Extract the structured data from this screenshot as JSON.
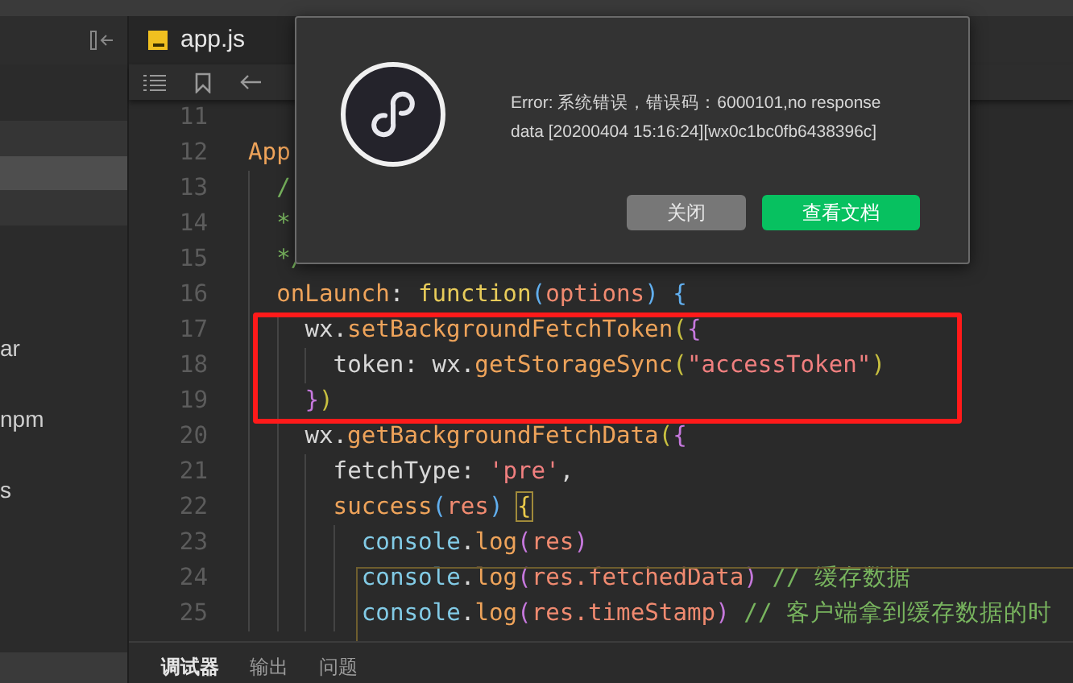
{
  "sidebar": {
    "rows": [
      {
        "selected": false
      },
      {
        "selected": true
      },
      {
        "selected": false
      }
    ],
    "items": [
      {
        "label": "ar"
      },
      {
        "label": "npm"
      },
      {
        "label": "s"
      }
    ]
  },
  "editor": {
    "tabs": [
      {
        "label": "app.js",
        "selected": true
      }
    ],
    "lines": [
      {
        "number": "11"
      },
      {
        "number": "12",
        "tokens": [
          {
            "kind": "method",
            "text": "App"
          }
        ],
        "children": [
          {
            "number": "13",
            "tokens": [
              {
                "kind": "comment",
                "text": "/"
              }
            ]
          },
          {
            "number": "14",
            "tokens": [
              {
                "kind": "comment",
                "text": "*"
              }
            ]
          },
          {
            "number": "15",
            "tokens": [
              {
                "kind": "comment",
                "text": "*/"
              }
            ]
          },
          {
            "number": "16",
            "tokens": [
              {
                "kind": "method",
                "text": "onLaunch"
              },
              {
                "kind": "text",
                "text": ": "
              },
              {
                "kind": "keyword",
                "text": "function"
              },
              {
                "kind": "brace3",
                "text": "("
              },
              {
                "kind": "param",
                "text": "options"
              },
              {
                "kind": "brace3",
                "text": ") "
              },
              {
                "kind": "brace3",
                "text": "{"
              }
            ],
            "children": [
              {
                "number": "17",
                "tokens": [
                  {
                    "kind": "text",
                    "text": "wx."
                  },
                  {
                    "kind": "method",
                    "text": "setBackgroundFetchToken"
                  },
                  {
                    "kind": "brace1",
                    "text": "("
                  },
                  {
                    "kind": "brace2",
                    "text": "{"
                  }
                ],
                "children": [
                  {
                    "number": "18",
                    "tokens": [
                      {
                        "kind": "text",
                        "text": "token: wx."
                      },
                      {
                        "kind": "method",
                        "text": "getStorageSync"
                      },
                      {
                        "kind": "brace1",
                        "text": "("
                      },
                      {
                        "kind": "string",
                        "text": "\"accessToken\""
                      },
                      {
                        "kind": "brace1",
                        "text": ")"
                      }
                    ]
                  }
                ]
              },
              {
                "number": "19",
                "tokens": [
                  {
                    "kind": "brace2",
                    "text": "}"
                  },
                  {
                    "kind": "brace1",
                    "text": ")"
                  }
                ]
              },
              {
                "number": "20",
                "tokens": [
                  {
                    "kind": "text",
                    "text": "wx."
                  },
                  {
                    "kind": "method",
                    "text": "getBackgroundFetchData"
                  },
                  {
                    "kind": "brace1",
                    "text": "("
                  },
                  {
                    "kind": "brace2",
                    "text": "{"
                  }
                ],
                "children": [
                  {
                    "number": "21",
                    "tokens": [
                      {
                        "kind": "text",
                        "text": "fetchType: "
                      },
                      {
                        "kind": "string",
                        "text": "'pre'"
                      },
                      {
                        "kind": "text",
                        "text": ","
                      }
                    ]
                  },
                  {
                    "number": "22",
                    "tokens": [
                      {
                        "kind": "method",
                        "text": "success"
                      },
                      {
                        "kind": "brace3",
                        "text": "("
                      },
                      {
                        "kind": "param",
                        "text": "res"
                      },
                      {
                        "kind": "brace3",
                        "text": ") "
                      },
                      {
                        "kind": "match",
                        "text": "{"
                      }
                    ],
                    "children": [
                      {
                        "number": "23",
                        "tokens": [
                          {
                            "kind": "object",
                            "text": "console"
                          },
                          {
                            "kind": "text",
                            "text": "."
                          },
                          {
                            "kind": "method",
                            "text": "log"
                          },
                          {
                            "kind": "brace2",
                            "text": "("
                          },
                          {
                            "kind": "param",
                            "text": "res"
                          },
                          {
                            "kind": "brace2",
                            "text": ")"
                          }
                        ]
                      },
                      {
                        "number": "24",
                        "tokens": [
                          {
                            "kind": "object",
                            "text": "console"
                          },
                          {
                            "kind": "text",
                            "text": "."
                          },
                          {
                            "kind": "method",
                            "text": "log"
                          },
                          {
                            "kind": "brace2",
                            "text": "("
                          },
                          {
                            "kind": "param",
                            "text": "res.fetchedData"
                          },
                          {
                            "kind": "brace2",
                            "text": ") "
                          },
                          {
                            "kind": "comment",
                            "text": "// 缓存数据"
                          }
                        ]
                      },
                      {
                        "number": "25",
                        "tokens": [
                          {
                            "kind": "object",
                            "text": "console"
                          },
                          {
                            "kind": "text",
                            "text": "."
                          },
                          {
                            "kind": "method",
                            "text": "log"
                          },
                          {
                            "kind": "brace2",
                            "text": "("
                          },
                          {
                            "kind": "param",
                            "text": "res.timeStamp"
                          },
                          {
                            "kind": "brace2",
                            "text": ") "
                          },
                          {
                            "kind": "comment",
                            "text": "// 客户端拿到缓存数据的时"
                          }
                        ]
                      }
                    ]
                  }
                ]
              }
            ]
          }
        ]
      }
    ]
  },
  "dialog": {
    "message": "Error: 系统错误，错误码：6000101,no response data [20200404 15:16:24][wx0c1bc0fb6438396c]",
    "buttons": [
      {
        "label": "关闭",
        "kind": "secondary"
      },
      {
        "label": "查看文档",
        "kind": "primary"
      }
    ]
  },
  "panel": {
    "tabs": [
      {
        "label": "调试器",
        "selected": true
      },
      {
        "label": "输出",
        "selected": false
      },
      {
        "label": "问题",
        "selected": false
      }
    ]
  }
}
